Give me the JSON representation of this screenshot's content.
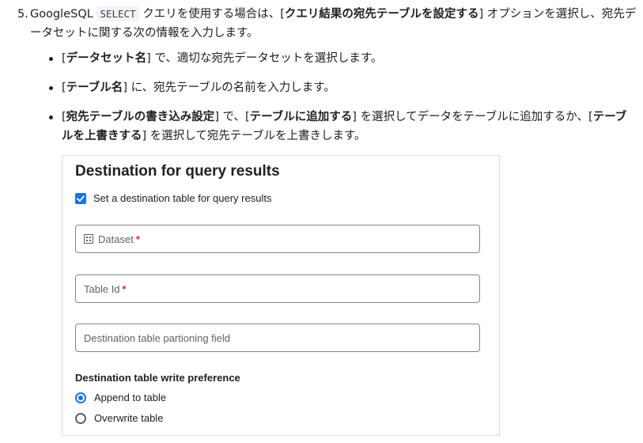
{
  "step": {
    "number": "5.",
    "p1": "GoogleSQL ",
    "code": "SELECT",
    "p2": " クエリを使用する場合は、[",
    "b1": "クエリ結果の宛先テーブルを設定する",
    "p3": "] オプションを選択し、宛先データセットに関する次の情報を入力します。"
  },
  "bullets": [
    {
      "pre": "[",
      "bold": "データセット名",
      "post": "] で、適切な宛先データセットを選択します。"
    },
    {
      "pre": "[",
      "bold": "テーブル名",
      "post": "] に、宛先テーブルの名前を入力します。"
    },
    {
      "pre": "[",
      "bold": "宛先テーブルの書き込み設定",
      "mid1": "] で、[",
      "bold2": "テーブルに追加する",
      "mid2": "] を選択してデータをテーブルに追加するか、[",
      "bold3": "テーブルを上書きする",
      "post": "] を選択して宛先テーブルを上書きします。"
    }
  ],
  "panel": {
    "title": "Destination for query results",
    "checkbox_label": "Set a destination table for query results",
    "checkbox_checked": true,
    "fields": [
      {
        "label": "Dataset",
        "required": "*",
        "icon": "dataset-grid-icon",
        "value": ""
      },
      {
        "label": "Table Id",
        "required": "*",
        "value": ""
      },
      {
        "label": "Destination table partioning field",
        "required": "",
        "value": ""
      }
    ],
    "write_pref_title": "Destination table write preference",
    "options": [
      {
        "label": "Append to table",
        "selected": true
      },
      {
        "label": "Overwrite table",
        "selected": false
      }
    ]
  },
  "colors": {
    "accent": "#1a73e8",
    "required": "#d93025",
    "border": "#80868b"
  }
}
